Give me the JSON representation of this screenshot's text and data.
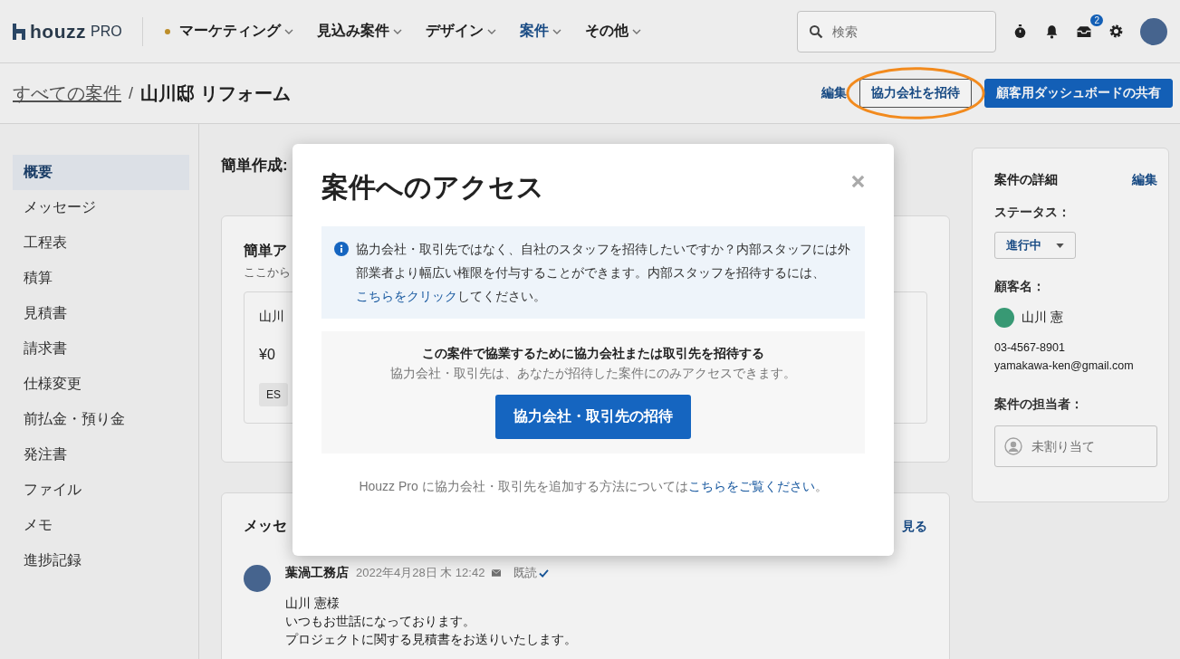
{
  "header": {
    "logo": {
      "brand": "houzz",
      "suffix": "PRO"
    },
    "nav": [
      {
        "label": "マーケティング",
        "selected": false,
        "dot": true
      },
      {
        "label": "見込み案件",
        "selected": false,
        "dot": false
      },
      {
        "label": "デザイン",
        "selected": false,
        "dot": false
      },
      {
        "label": "案件",
        "selected": true,
        "dot": false
      },
      {
        "label": "その他",
        "selected": false,
        "dot": false
      }
    ],
    "search": {
      "placeholder": "検索"
    },
    "inbox_badge": "2"
  },
  "breadcrumb": {
    "parent": "すべての案件",
    "separator": "/",
    "current": "山川邸 リフォーム"
  },
  "actions": [
    {
      "label": "編集",
      "kind": "link",
      "highlighted": false
    },
    {
      "label": "協力会社を招待",
      "kind": "outline",
      "highlighted": true
    },
    {
      "label": "顧客用ダッシュボードの共有",
      "kind": "primary",
      "highlighted": false
    }
  ],
  "sidebar": {
    "items": [
      {
        "label": "概要",
        "selected": true
      },
      {
        "label": "メッセージ",
        "selected": false
      },
      {
        "label": "工程表",
        "selected": false
      },
      {
        "label": "積算",
        "selected": false
      },
      {
        "label": "見積書",
        "selected": false
      },
      {
        "label": "請求書",
        "selected": false
      },
      {
        "label": "仕様変更",
        "selected": false
      },
      {
        "label": "前払金・預り金",
        "selected": false
      },
      {
        "label": "発注書",
        "selected": false
      },
      {
        "label": "ファイル",
        "selected": false
      },
      {
        "label": "メモ",
        "selected": false
      },
      {
        "label": "進捗記録",
        "selected": false
      }
    ]
  },
  "main": {
    "quick_create_label": "簡単作成:",
    "quick_actions": {
      "title": "簡単ア",
      "subtitle": "ここから",
      "project": {
        "name": "山川",
        "amount": "¥0",
        "tag": "ES"
      }
    },
    "messages": {
      "title": "メッセ",
      "link": "見る",
      "items": [
        {
          "sender": "葉渦工務店",
          "date": "2022年4月28日 木 12:42",
          "status": "既読",
          "read": true,
          "lines": [
            "山川 憲様",
            "いつもお世話になっております。",
            "プロジェクトに関する見積書をお送りいたします。"
          ]
        }
      ]
    }
  },
  "details": {
    "title": "案件の詳細",
    "edit": "編集",
    "status_label": "ステータス：",
    "status": "進行中",
    "client_label": "顧客名：",
    "client_name": "山川 憲",
    "phone": "03-4567-8901",
    "email": "yamakawa-ken@gmail.com",
    "assignee_label": "案件の担当者：",
    "assignee_placeholder": "未割り当て"
  },
  "modal": {
    "title": "案件へのアクセス",
    "info": {
      "text": "協力会社・取引先ではなく、自社のスタッフを招待したいですか？内部スタッフには外部業者より幅広い権限を付与することができます。内部スタッフを招待するには、",
      "link": "こちらをクリック",
      "after": "してください。"
    },
    "invite": {
      "heading": "この案件で協業するために協力会社または取引先を招待する",
      "subtext": "協力会社・取引先は、あなたが招待した案件にのみアクセスできます。",
      "button": "協力会社・取引先の招待"
    },
    "footer": {
      "text": "Houzz Pro に協力会社・取引先を追加する方法については",
      "link": "こちらをご覧ください",
      "after": "。"
    }
  }
}
